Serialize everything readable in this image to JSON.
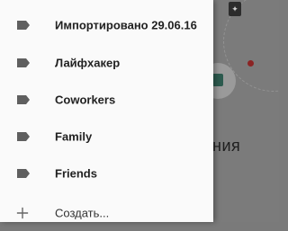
{
  "drawer": {
    "items": [
      {
        "label": "Импортировано 29.06.16",
        "icon": "label-icon"
      },
      {
        "label": "Лайфхакер",
        "icon": "label-icon"
      },
      {
        "label": "Coworkers",
        "icon": "label-icon"
      },
      {
        "label": "Family",
        "icon": "label-icon"
      },
      {
        "label": "Friends",
        "icon": "label-icon"
      }
    ],
    "create": {
      "label": "Создать...",
      "icon": "plus-icon"
    }
  },
  "background": {
    "heading_fragment": "ния"
  },
  "colors": {
    "drawer_bg": "#fafafa",
    "scrim": "#7b7b7b",
    "label_icon": "#5f5f5f",
    "text": "#212121"
  }
}
